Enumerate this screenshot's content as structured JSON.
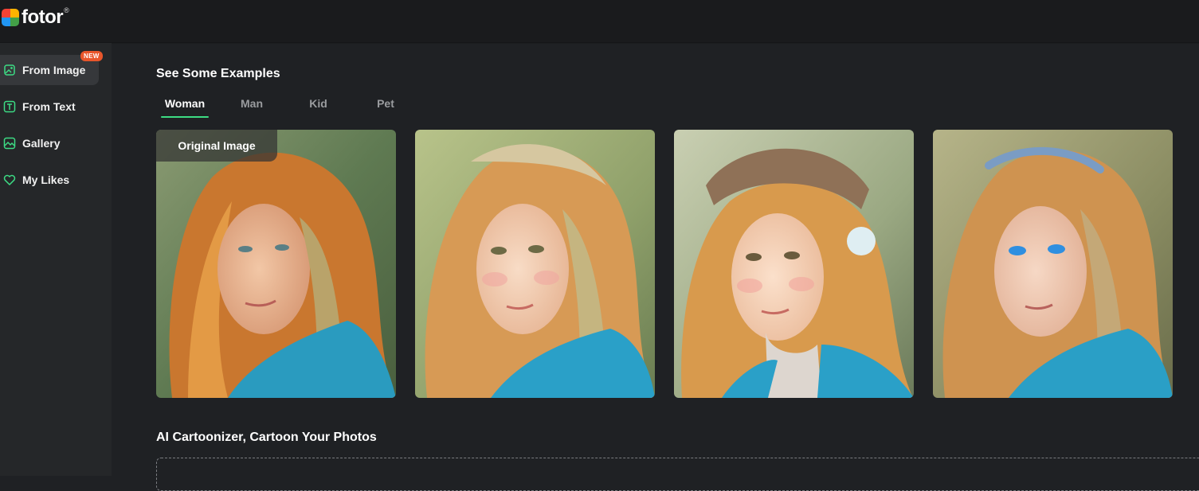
{
  "app": {
    "logo_text": "fotor",
    "logo_reg": "®",
    "brand_colors": [
      "#f44336",
      "#ffb300",
      "#2196f3",
      "#43a047"
    ]
  },
  "sidebar": {
    "items": [
      {
        "label": "From Image",
        "icon": "image-edit-icon",
        "active": true,
        "badge": "NEW"
      },
      {
        "label": "From Text",
        "icon": "text-box-icon",
        "active": false
      },
      {
        "label": "Gallery",
        "icon": "gallery-icon",
        "active": false
      },
      {
        "label": "My Likes",
        "icon": "heart-icon",
        "active": false
      }
    ]
  },
  "examples": {
    "title": "See Some Examples",
    "tabs": [
      {
        "label": "Woman",
        "active": true
      },
      {
        "label": "Man",
        "active": false
      },
      {
        "label": "Kid",
        "active": false
      },
      {
        "label": "Pet",
        "active": false
      }
    ],
    "original_label": "Original Image",
    "cards": [
      {
        "name": "original-photo"
      },
      {
        "name": "cartoon-style-1"
      },
      {
        "name": "cartoon-style-beanie"
      },
      {
        "name": "cartoon-style-blue-eyes"
      }
    ]
  },
  "cartoonizer": {
    "title": "AI Cartoonizer, Cartoon Your Photos"
  },
  "colors": {
    "accent": "#3ddc84",
    "badge": "#e8562b",
    "background": "#1f2124",
    "sidebar": "#252729",
    "topbar": "#1a1b1d"
  }
}
